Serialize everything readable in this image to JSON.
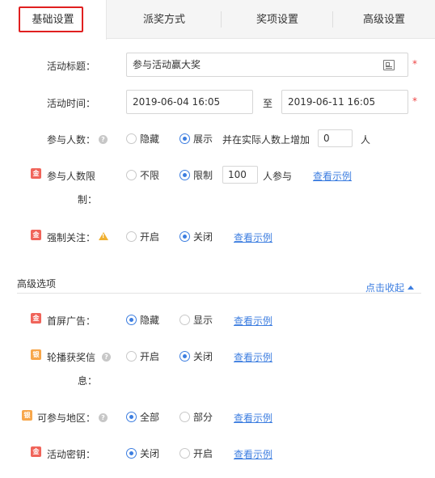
{
  "tabs": [
    {
      "label": "基础设置",
      "active": true
    },
    {
      "label": "派奖方式",
      "active": false
    },
    {
      "label": "奖项设置",
      "active": false
    },
    {
      "label": "高级设置",
      "active": false
    }
  ],
  "form": {
    "title": {
      "label": "活动标题：",
      "value": "参与活动赢大奖",
      "required_mark": "*"
    },
    "time": {
      "label": "活动时间：",
      "start": "2019-06-04 16:05",
      "separator": "至",
      "end": "2019-06-11 16:05",
      "required_mark": "*"
    },
    "participants": {
      "label": "参与人数：",
      "options": [
        "隐藏",
        "展示"
      ],
      "selected": "展示",
      "extra_text": "并在实际人数上增加",
      "extra_value": "0",
      "unit": "人"
    },
    "limit": {
      "label_line1": "参与人数限",
      "label_line2": "制：",
      "badge": "金",
      "options": [
        "不限",
        "限制"
      ],
      "selected": "限制",
      "value": "100",
      "unit": "人参与",
      "example": "查看示例"
    },
    "follow": {
      "label": "强制关注：",
      "badge": "金",
      "options": [
        "开启",
        "关闭"
      ],
      "selected": "关闭",
      "example": "查看示例"
    }
  },
  "advanced": {
    "title": "高级选项",
    "collapse_label": "点击收起",
    "splash": {
      "label": "首屏广告：",
      "badge": "金",
      "options": [
        "隐藏",
        "显示"
      ],
      "selected": "隐藏",
      "example": "查看示例"
    },
    "carousel": {
      "label_line1": "轮播获奖信",
      "label_line2": "息：",
      "badge": "银",
      "options": [
        "开启",
        "关闭"
      ],
      "selected": "关闭",
      "example": "查看示例"
    },
    "region": {
      "label": "可参与地区：",
      "badge": "银",
      "options": [
        "全部",
        "部分"
      ],
      "selected": "全部",
      "example": "查看示例"
    },
    "password": {
      "label": "活动密钥：",
      "badge": "金",
      "options": [
        "关闭",
        "开启"
      ],
      "selected": "关闭",
      "example": "查看示例"
    }
  },
  "colors": {
    "accent": "#3d7ee0",
    "highlight_border": "#e02020",
    "required": "#ee4444"
  }
}
